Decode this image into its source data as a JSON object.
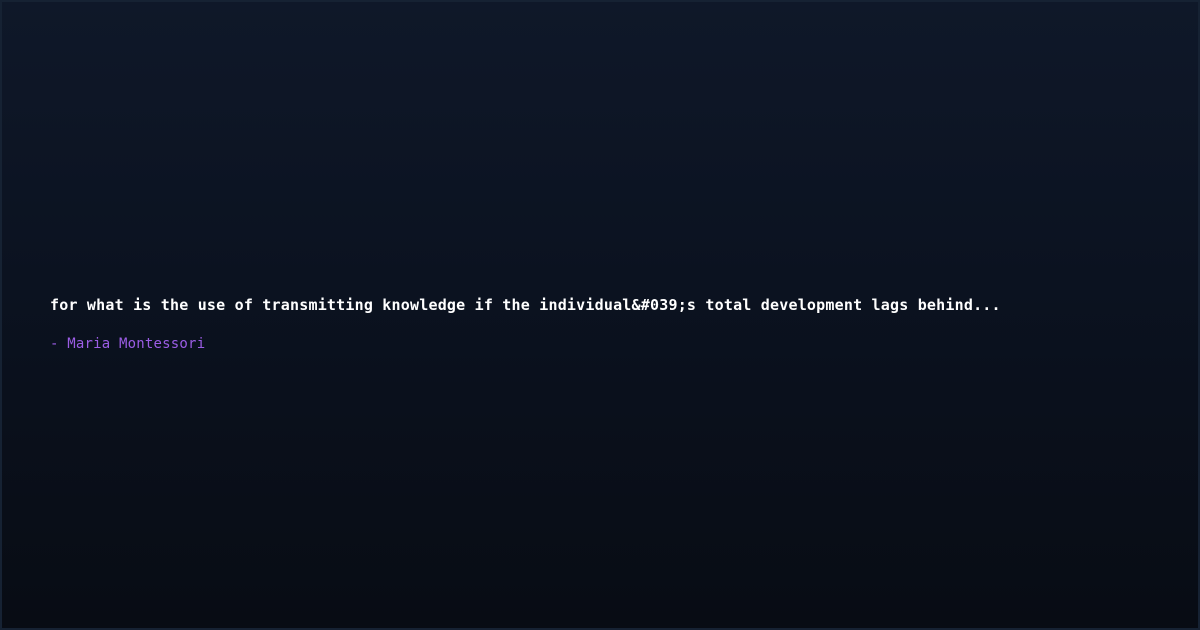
{
  "quote": {
    "text": "for what is the use of transmitting knowledge if the individual&#039;s total development lags behind...",
    "author": "- Maria Montessori"
  },
  "colors": {
    "background": "#0b1220",
    "quote_text": "#ffffff",
    "author_text": "#9b5de5"
  }
}
